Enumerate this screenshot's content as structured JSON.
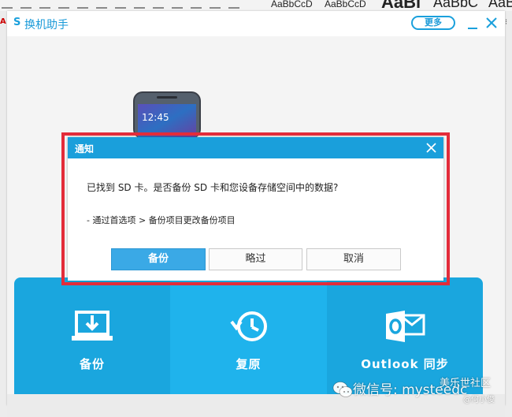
{
  "background_doc": {
    "style_samples": [
      "AaBbCcD",
      "AaBbCcD",
      "AaBl",
      "AaBbC",
      "AaB"
    ]
  },
  "app": {
    "logo": "S",
    "title": "换机助手",
    "more_label": "更多"
  },
  "dialog": {
    "title": "通知",
    "message": "已找到 SD 卡。是否备份 SD 卡和您设备存储空间中的数据?",
    "hint": "- 通过首选项 > 备份项目更改备份项目",
    "buttons": {
      "backup": "备份",
      "skip": "略过",
      "cancel": "取消"
    }
  },
  "tiles": [
    {
      "label": "备份",
      "icon": "backup-laptop-icon"
    },
    {
      "label": "复原",
      "icon": "restore-clock-icon"
    },
    {
      "label": "Outlook 同步",
      "icon": "outlook-icon"
    }
  ],
  "watermark": {
    "text": "微信号: mysteedc",
    "corner": "美乐世社区",
    "sub": "@何小俊"
  },
  "colors": {
    "accent": "#1a9fdb",
    "highlight_frame": "#e32c3a",
    "tile": "#1aa6de"
  }
}
